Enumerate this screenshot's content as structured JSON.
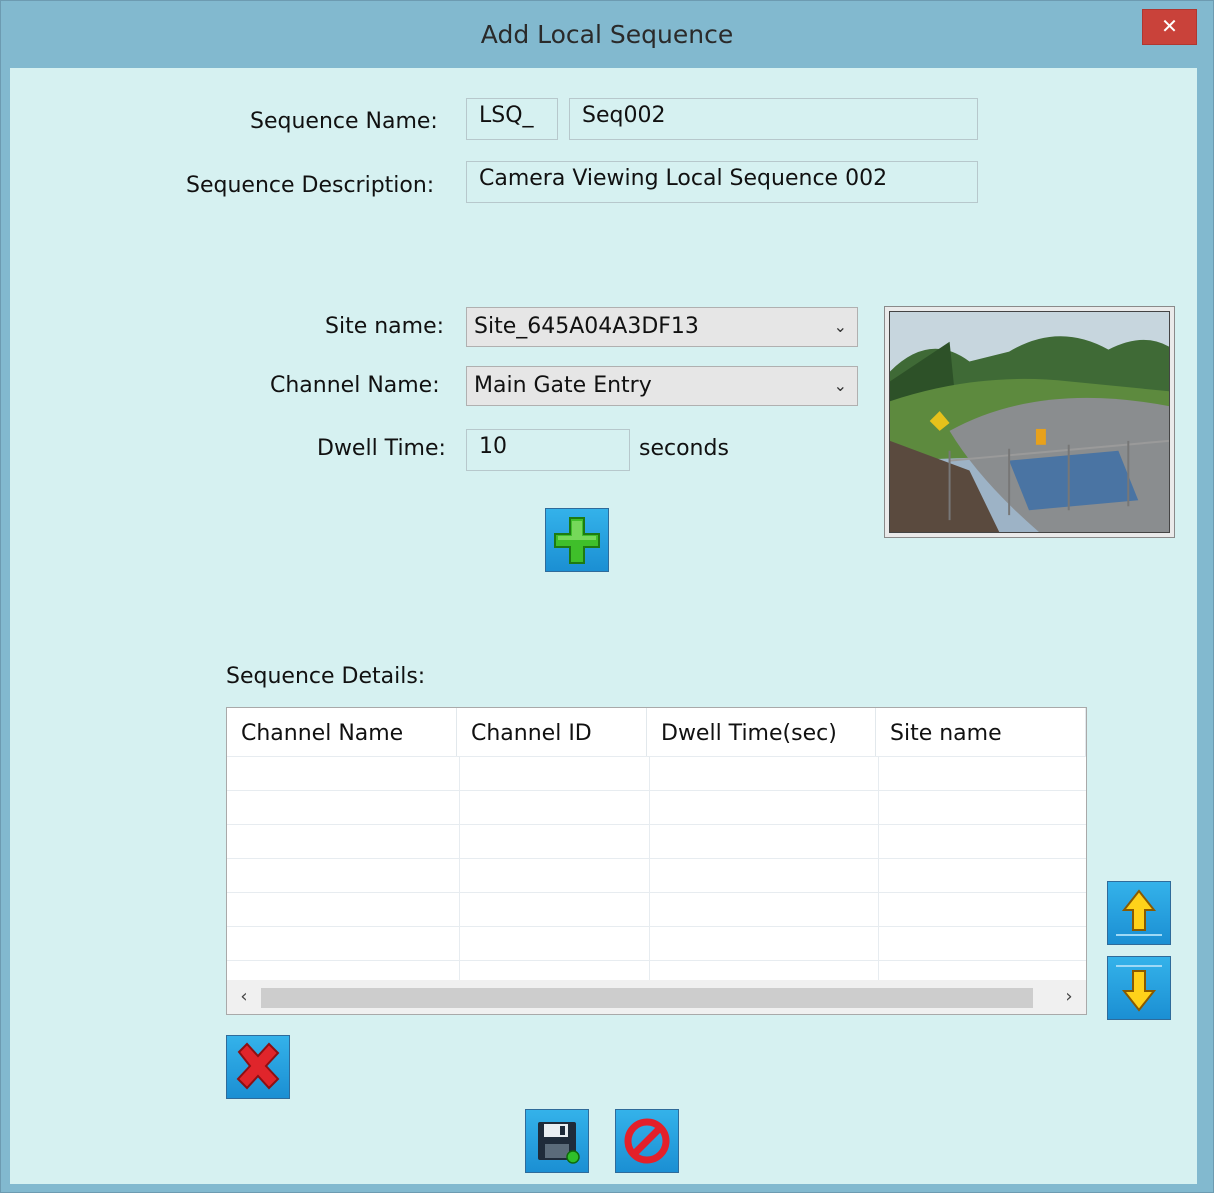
{
  "window": {
    "title": "Add Local Sequence",
    "close_glyph": "✕"
  },
  "sequence_name": {
    "label": "Sequence Name:",
    "prefix": "LSQ_",
    "value": "Seq002"
  },
  "sequence_description": {
    "label": "Sequence Description:",
    "value": "Camera Viewing Local Sequence 002"
  },
  "site": {
    "label": "Site name:",
    "selected": "Site_645A04A3DF13"
  },
  "channel": {
    "label": "Channel Name:",
    "selected": "Main Gate Entry"
  },
  "dwell": {
    "label": "Dwell Time:",
    "value": "10",
    "unit": "seconds"
  },
  "details": {
    "label": "Sequence Details:",
    "columns": [
      "Channel Name",
      "Channel ID",
      "Dwell Time(sec)",
      "Site name"
    ],
    "rows": []
  },
  "scroll": {
    "left_glyph": "‹",
    "right_glyph": "›"
  },
  "icons": {
    "add": "green-plus-icon",
    "move_up": "yellow-up-arrow-icon",
    "move_down": "yellow-down-arrow-icon",
    "delete": "red-x-icon",
    "save": "floppy-disk-icon",
    "cancel": "no-entry-icon"
  },
  "colors": {
    "title_bar": "#82b9cf",
    "client_bg": "#d6f1f1",
    "close_button": "#c9423a",
    "icon_button": "#1b8fd3"
  }
}
